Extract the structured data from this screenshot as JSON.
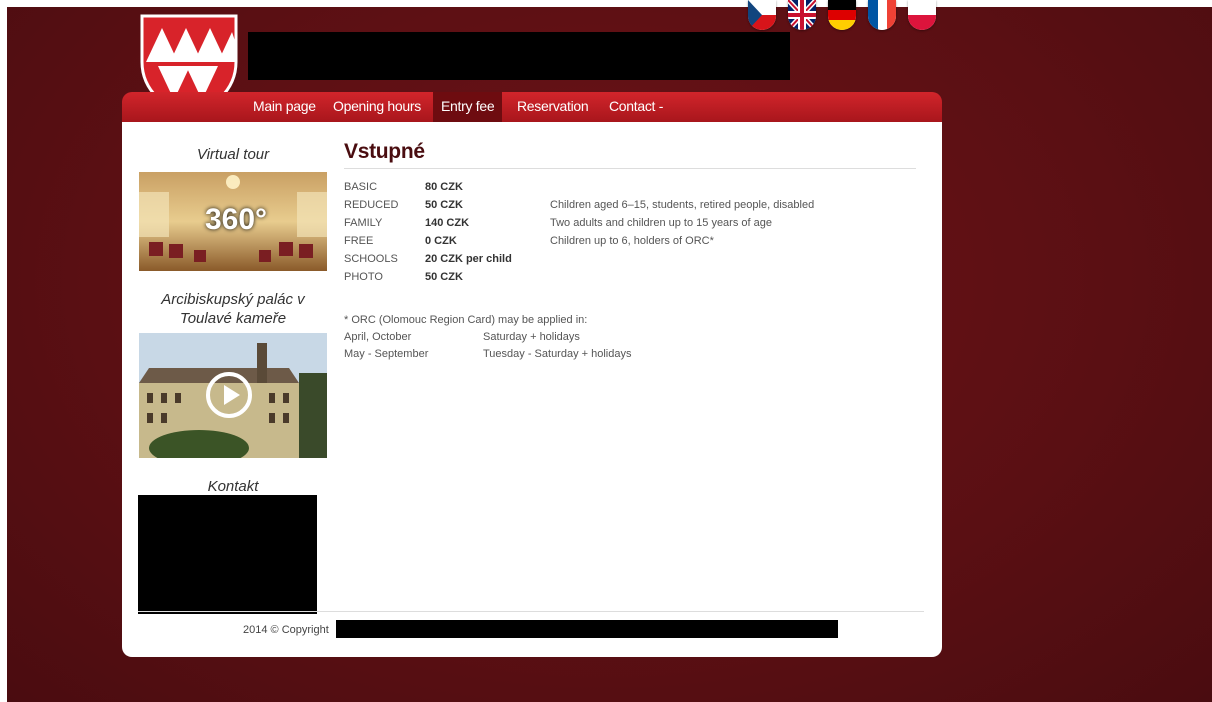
{
  "colors": {
    "background": "#5e1014",
    "nav_red": "#c31f25",
    "nav_active": "#6e0c10",
    "title": "#4a0d10"
  },
  "header": {
    "flags": [
      "czech-flag-icon",
      "uk-flag-icon",
      "german-flag-icon",
      "french-flag-icon",
      "polish-flag-icon"
    ]
  },
  "nav": {
    "items": [
      {
        "label": "Main page"
      },
      {
        "label": "Opening hours"
      },
      {
        "label": "Entry fee"
      },
      {
        "label": "Reservation"
      },
      {
        "label": "Contact -"
      }
    ]
  },
  "sidebar": {
    "virtual_tour_title": "Virtual tour",
    "virtual_tour_badge": "360°",
    "camera_title": "Arcibiskupský palác v Toulavé kameře",
    "contact_title": "Kontakt"
  },
  "main": {
    "title": "Vstupné",
    "fees": [
      {
        "label": "BASIC",
        "price": "80 CZK",
        "note": ""
      },
      {
        "label": "REDUCED",
        "price": "50 CZK",
        "note": "Children aged 6–15, students, retired people, disabled"
      },
      {
        "label": "FAMILY",
        "price": "140 CZK",
        "note": "Two adults and children up to 15 years of age"
      },
      {
        "label": "FREE",
        "price": "0 CZK",
        "note": "Children up to 6, holders of ORC*"
      },
      {
        "label": "SCHOOLS",
        "price": "20 CZK per child",
        "note": ""
      },
      {
        "label": "PHOTO",
        "price": "50 CZK",
        "note": ""
      }
    ],
    "orc_note": "* ORC (Olomouc Region Card) may be applied in:",
    "orc_periods": [
      {
        "period": "April, October",
        "days": "Saturday + holidays"
      },
      {
        "period": "May - September",
        "days": "Tuesday - Saturday + holidays"
      }
    ]
  },
  "footer": {
    "copyright": "2014 © Copyright"
  }
}
